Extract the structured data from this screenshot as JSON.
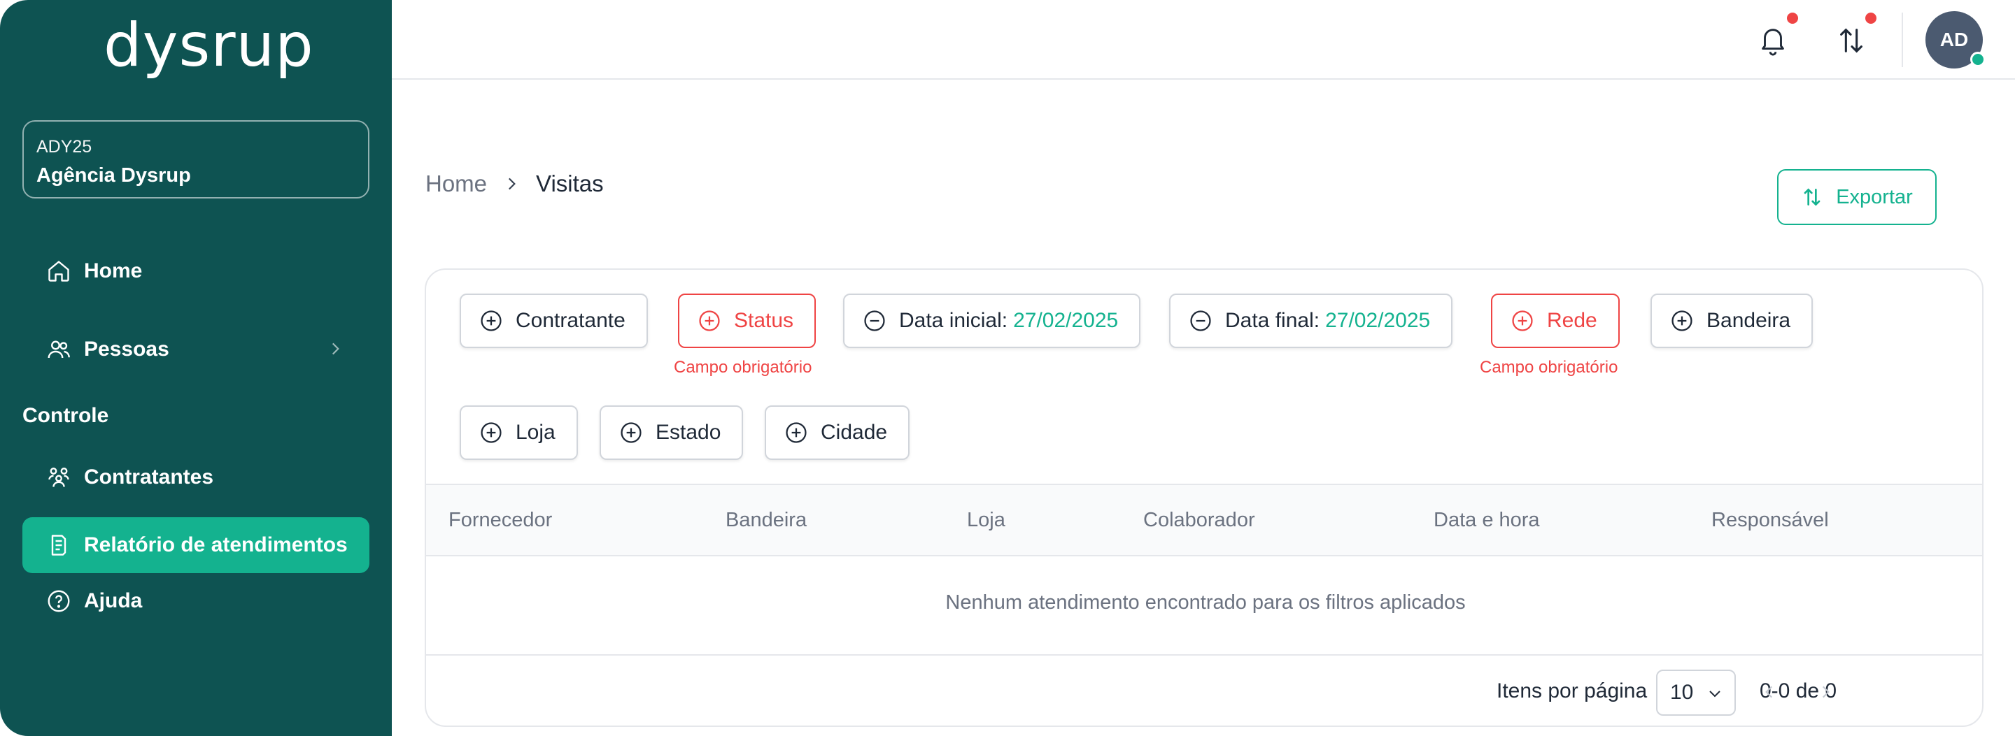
{
  "brand": {
    "logo_text": "dysrup"
  },
  "agency": {
    "code": "ADY25",
    "name": "Agência Dysrup"
  },
  "sidebar": {
    "items": [
      {
        "label": "Home",
        "icon": "home-icon"
      },
      {
        "label": "Pessoas",
        "icon": "users-icon",
        "has_submenu": true
      }
    ],
    "section_title": "Controle",
    "control_items": [
      {
        "label": "Contratantes",
        "icon": "group-icon"
      },
      {
        "label": "Relatório de atendimentos",
        "icon": "report-icon",
        "active": true
      },
      {
        "label": "Ajuda",
        "icon": "help-icon"
      }
    ]
  },
  "header": {
    "avatar_initials": "AD",
    "notifications_badge": true,
    "transfers_badge": true
  },
  "breadcrumb": {
    "home": "Home",
    "current": "Visitas"
  },
  "actions": {
    "export_label": "Exportar"
  },
  "filters": {
    "contratante": "Contratante",
    "status": "Status",
    "data_inicial_label": "Data inicial:",
    "data_inicial_value": "27/02/2025",
    "data_final_label": "Data final:",
    "data_final_value": "27/02/2025",
    "rede": "Rede",
    "bandeira": "Bandeira",
    "loja": "Loja",
    "estado": "Estado",
    "cidade": "Cidade",
    "required_msg": "Campo obrigatório"
  },
  "table": {
    "columns": [
      "Fornecedor",
      "Bandeira",
      "Loja",
      "Colaborador",
      "Data e hora",
      "Responsável"
    ],
    "empty_message": "Nenhum atendimento encontrado para os filtros aplicados"
  },
  "pagination": {
    "per_page_label": "Itens por página",
    "per_page_value": "10",
    "range": "0-0 de 0"
  },
  "colors": {
    "sidebar_bg": "#0e5352",
    "accent": "#14b28f",
    "error": "#ef4444"
  }
}
